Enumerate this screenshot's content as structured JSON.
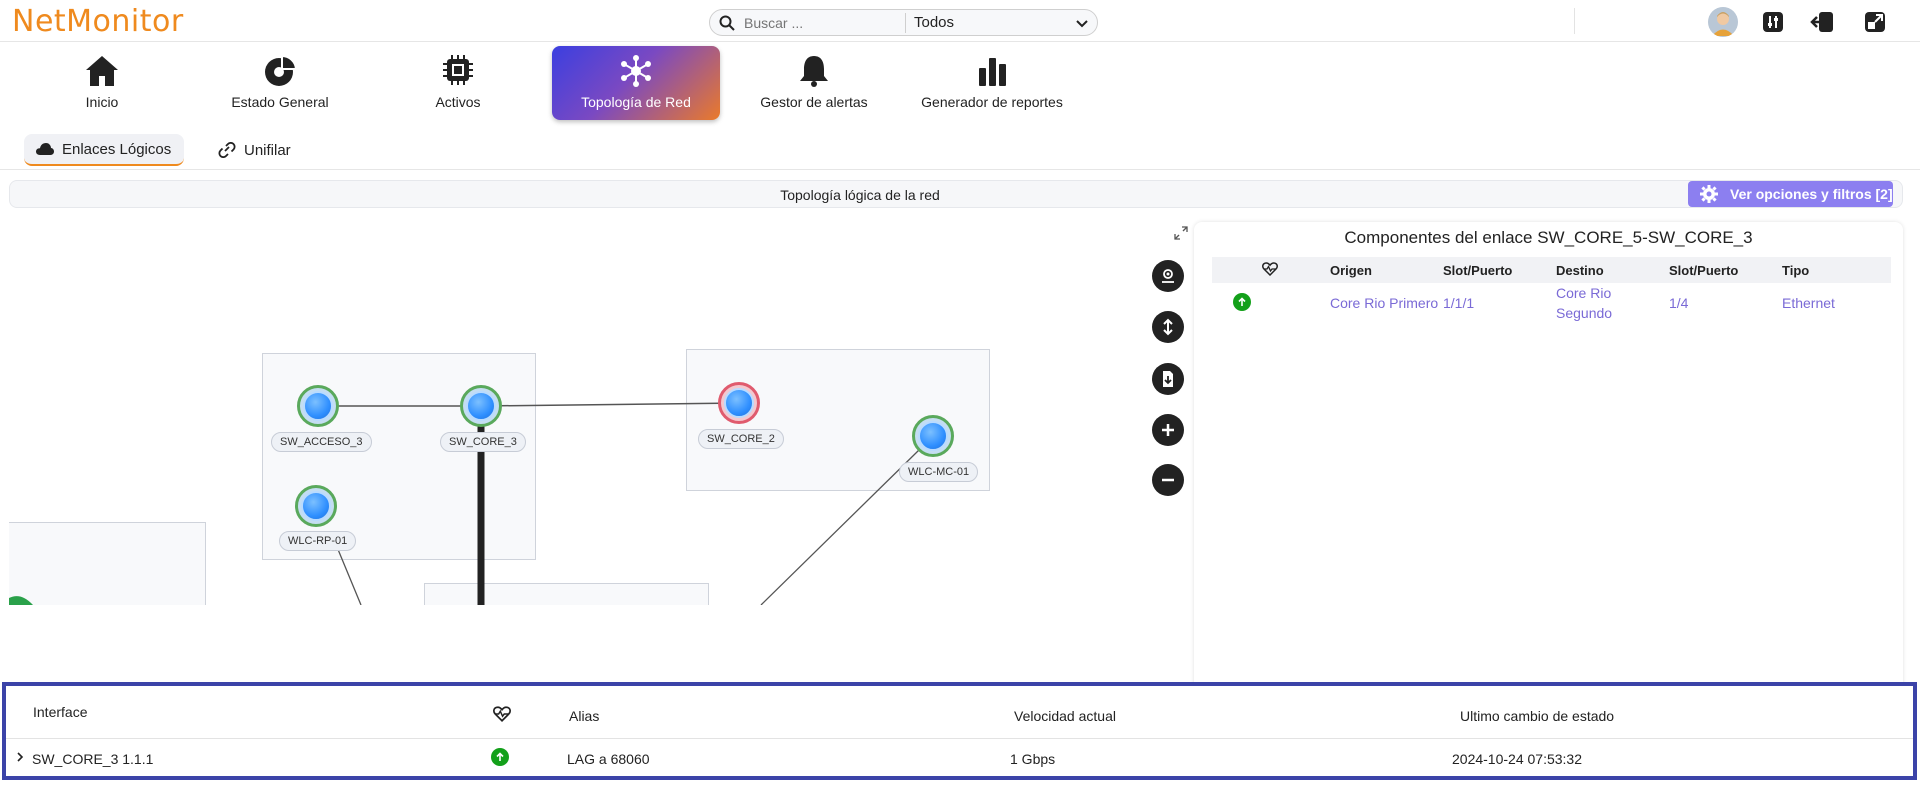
{
  "app": {
    "logo": "NetMonitor",
    "accent": "#ef8a1e"
  },
  "search": {
    "placeholder": "Buscar ...",
    "scope": "Todos"
  },
  "nav": {
    "items": [
      {
        "label": "Inicio",
        "icon": "home-icon"
      },
      {
        "label": "Estado General",
        "icon": "pie-chart-icon"
      },
      {
        "label": "Activos",
        "icon": "chip-icon"
      },
      {
        "label": "Topología de Red",
        "icon": "network-icon",
        "active": true
      },
      {
        "label": "Gestor de alertas",
        "icon": "bell-icon"
      },
      {
        "label": "Generador de reportes",
        "icon": "bar-chart-icon"
      }
    ]
  },
  "subtabs": {
    "logical": "Enlaces Lógicos",
    "unifilar": "Unifilar"
  },
  "topology": {
    "title": "Topología lógica de la red",
    "options_button": "Ver opciones y filtros [2]",
    "nodes": {
      "sw_acceso_3": "SW_ACCESO_3",
      "sw_core_3": "SW_CORE_3",
      "sw_core_2": "SW_CORE_2",
      "wlc_mc_01": "WLC-MC-01",
      "wlc_rp_01": "WLC-RP-01"
    }
  },
  "link_panel": {
    "title": "Componentes del enlace SW_CORE_5-SW_CORE_3",
    "headers": {
      "origin": "Origen",
      "slot1": "Slot/Puerto",
      "dest": "Destino",
      "slot2": "Slot/Puerto",
      "type": "Tipo"
    },
    "row": {
      "origin": "Core Rio Primero",
      "slot1": "1/1/1",
      "dest_line1": "Core Rio",
      "dest_line2": "Segundo",
      "slot2": "1/4",
      "type": "Ethernet"
    }
  },
  "interfaces": {
    "headers": {
      "interface": "Interface",
      "alias": "Alias",
      "speed": "Velocidad actual",
      "last_change": "Ultimo cambio de estado"
    },
    "row": {
      "interface": "SW_CORE_3 1.1.1",
      "alias": "LAG a 68060",
      "speed": "1 Gbps",
      "last_change": "2024-10-24 07:53:32"
    }
  }
}
